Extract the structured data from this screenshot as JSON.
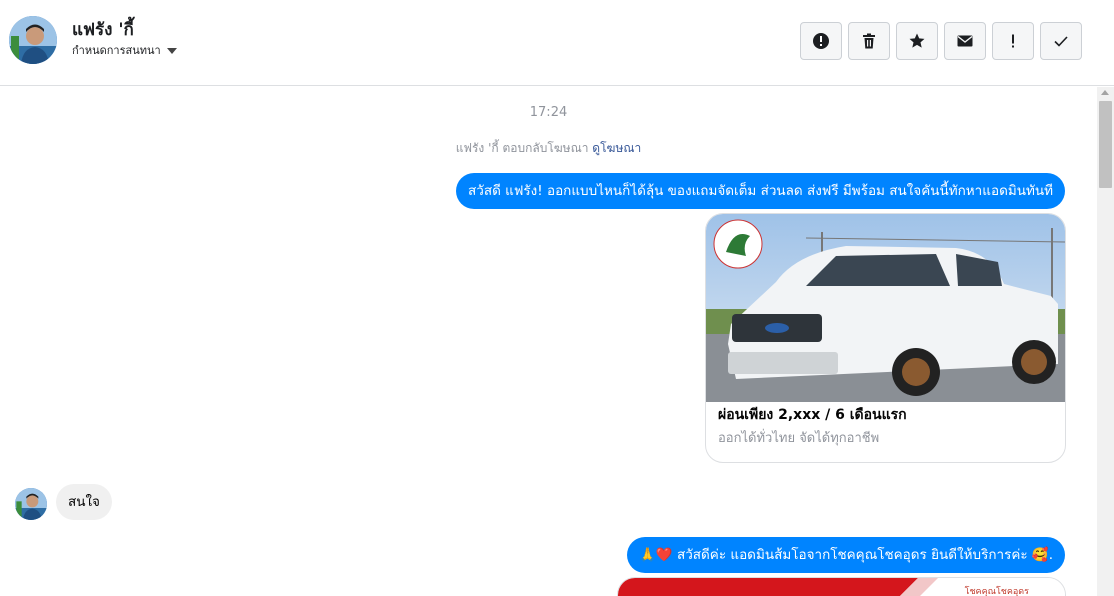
{
  "header": {
    "contact_name": "แฟรัง 'กี้",
    "assign_label": "กำหนดการสนทนา"
  },
  "toolbar": [
    {
      "name": "spam-button",
      "icon": "alert-circle-icon"
    },
    {
      "name": "delete-button",
      "icon": "trash-icon"
    },
    {
      "name": "star-button",
      "icon": "star-icon"
    },
    {
      "name": "mark-unread-button",
      "icon": "envelope-icon"
    },
    {
      "name": "follow-up-button",
      "icon": "exclamation-icon"
    },
    {
      "name": "done-button",
      "icon": "checkmark-icon"
    }
  ],
  "conversation": {
    "timestamp": "17:24",
    "ad_reply_text": "แฟรัง 'กี้ ตอบกลับโฆษณา",
    "ad_reply_link": "ดูโฆษณา",
    "messages": [
      {
        "direction": "out",
        "text": "สวัสดี แฟรัง! ออกแบบไหนก็ได้ลุ้น ของแถมจัดเต็ม ส่วนลด ส่งฟรี มีพร้อม สนใจคันนี้ทักหาแอดมินทันที"
      },
      {
        "direction": "in",
        "text": "สนใจ"
      },
      {
        "direction": "out",
        "text": "🙏❤️ สวัสดีค่ะ แอดมินส้มโอจากโชคคุณโชคอุดร ยินดีให้บริการค่ะ 🥰."
      }
    ],
    "ad_card": {
      "title": "ผ่อนเพียง 2,xxx / 6 เดือนแรก",
      "subtitle": "ออกได้ทั่วไทย จัดได้ทุกอาชีพ"
    },
    "partial_card_text": "โชคคุณโชคอุดร"
  },
  "colors": {
    "outgoing_bubble": "#0084ff",
    "incoming_bubble": "#f0f0f0",
    "link": "#385898",
    "muted": "#90949c"
  }
}
